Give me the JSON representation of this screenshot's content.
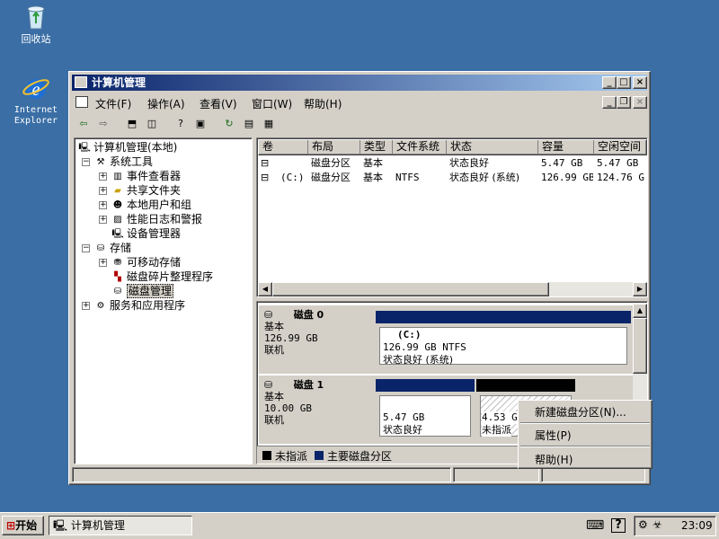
{
  "desktop": {
    "icons": [
      {
        "label": "回收站"
      },
      {
        "label_line1": "Internet",
        "label_line2": "Explorer"
      }
    ]
  },
  "window": {
    "title": "计算机管理",
    "menu": [
      "文件(F)",
      "操作(A)",
      "查看(V)",
      "窗口(W)",
      "帮助(H)"
    ],
    "tree": {
      "root": "计算机管理(本地)",
      "system_tools": "系统工具",
      "event_viewer": "事件查看器",
      "shared_folders": "共享文件夹",
      "local_users": "本地用户和组",
      "perf_logs": "性能日志和警报",
      "device_manager": "设备管理器",
      "storage": "存储",
      "removable_storage": "可移动存储",
      "defrag": "磁盘碎片整理程序",
      "disk_management": "磁盘管理",
      "services_apps": "服务和应用程序"
    },
    "list": {
      "columns": [
        "卷",
        "布局",
        "类型",
        "文件系统",
        "状态",
        "容量",
        "空闲空间"
      ],
      "rows": [
        {
          "volume": "",
          "layout": "磁盘分区",
          "type": "基本",
          "fs": "",
          "status": "状态良好",
          "capacity": "5.47 GB",
          "free": "5.47 GB"
        },
        {
          "volume": "(C:)",
          "layout": "磁盘分区",
          "type": "基本",
          "fs": "NTFS",
          "status": "状态良好 (系统)",
          "capacity": "126.99 GB",
          "free": "124.76 G"
        }
      ]
    },
    "disks": [
      {
        "name": "磁盘 0",
        "kind": "基本",
        "size": "126.99 GB",
        "state": "联机",
        "partitions": [
          {
            "label": "(C:)",
            "size": "126.99 GB NTFS",
            "status": "状态良好 (系统)"
          }
        ]
      },
      {
        "name": "磁盘 1",
        "kind": "基本",
        "size": "10.00 GB",
        "state": "联机",
        "partitions": [
          {
            "size": "5.47 GB",
            "status": "状态良好"
          },
          {
            "size": "4.53 G",
            "status": "未指派"
          }
        ]
      }
    ],
    "legend": {
      "unallocated": "未指派",
      "primary": "主要磁盘分区"
    },
    "context_menu": [
      "新建磁盘分区(N)...",
      "属性(P)",
      "帮助(H)"
    ]
  },
  "taskbar": {
    "start": "开始",
    "task": "计算机管理",
    "clock": "23:09"
  },
  "colors": {
    "desktop": "#3a6ea5",
    "titlebar": "#0a246a",
    "primary_partition": "#0a246a",
    "unallocated": "#000000"
  }
}
